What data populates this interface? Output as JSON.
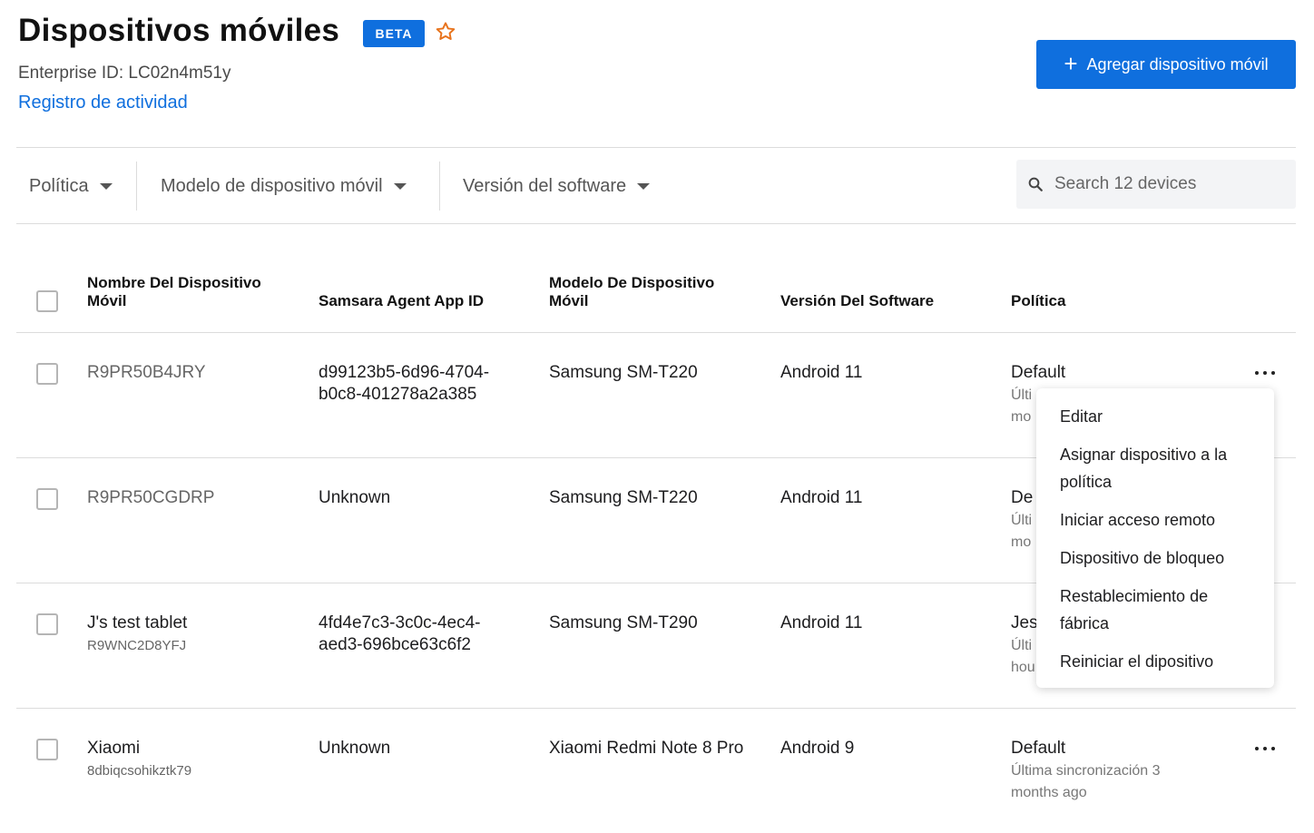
{
  "header": {
    "title": "Dispositivos móviles",
    "badge": "BETA",
    "enterprise_id": "Enterprise ID: LC02n4m51y",
    "activity_link": "Registro de actividad",
    "add_button": "Agregar dispositivo móvil",
    "add_icon": "+"
  },
  "filters": {
    "policy": "Política",
    "model": "Modelo de dispositivo móvil",
    "software": "Versión del software",
    "search_placeholder": "Search 12 devices"
  },
  "table": {
    "columns": {
      "name": "Nombre Del Dispositivo Móvil",
      "agent_id": "Samsara Agent App ID",
      "model": "Modelo De Dispositivo Móvil",
      "software": "Versión Del Software",
      "policy": "Política"
    },
    "rows": [
      {
        "name": "R9PR50B4JRY",
        "serial": "",
        "agent_id_1": "d99123b5-6d96-4704-",
        "agent_id_2": "b0c8-401278a2a385",
        "model": "Samsung SM-T220",
        "software": "Android 11",
        "policy": "Default",
        "sync_1": "Últi",
        "sync_2": "mo"
      },
      {
        "name": "R9PR50CGDRP",
        "serial": "",
        "agent_id_1": "Unknown",
        "agent_id_2": "",
        "model": "Samsung SM-T220",
        "software": "Android 11",
        "policy": "De",
        "sync_1": "Últi",
        "sync_2": "mo"
      },
      {
        "name": "J's test tablet",
        "serial": "R9WNC2D8YFJ",
        "agent_id_1": "4fd4e7c3-3c0c-4ec4-",
        "agent_id_2": "aed3-696bce63c6f2",
        "model": "Samsung SM-T290",
        "software": "Android 11",
        "policy": "Jes",
        "sync_1": "Últi",
        "sync_2": "hou"
      },
      {
        "name": "Xiaomi",
        "serial": "8dbiqcsohikztk79",
        "agent_id_1": "Unknown",
        "agent_id_2": "",
        "model": "Xiaomi Redmi Note 8 Pro",
        "software": "Android 9",
        "policy": "Default",
        "sync_1": "Última sincronización 3",
        "sync_2": "months ago"
      }
    ]
  },
  "menu": {
    "items": [
      "Editar",
      "Asignar dispositivo a la",
      "política",
      "Iniciar acceso remoto",
      "Dispositivo de bloqueo",
      "Restablecimiento de",
      "fábrica",
      "Reiniciar el dipositivo"
    ]
  },
  "colors": {
    "primary": "#0f6fde",
    "star": "#e8731c"
  }
}
